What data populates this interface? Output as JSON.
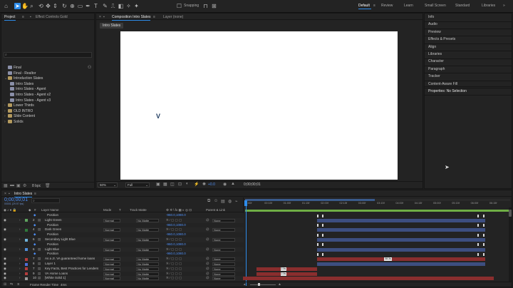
{
  "toolbar": {
    "snapping_label": "Snapping",
    "workspaces": [
      {
        "label": "Default",
        "active": true
      },
      {
        "label": "Review",
        "active": false
      },
      {
        "label": "Learn",
        "active": false
      },
      {
        "label": "Small Screen",
        "active": false
      },
      {
        "label": "Standard",
        "active": false
      },
      {
        "label": "Libraries",
        "active": false
      }
    ]
  },
  "project_panel": {
    "tab_project": "Project",
    "tab_effect_controls": "Effect Controls Gold",
    "search_placeholder": "",
    "items": [
      {
        "label": "Final",
        "type": "comp",
        "indent": 0
      },
      {
        "label": "Final - Realtor",
        "type": "comp",
        "indent": 0
      },
      {
        "label": "Introduction Slates",
        "type": "folder",
        "indent": 0
      },
      {
        "label": "Intro Slates",
        "type": "comp",
        "indent": 1
      },
      {
        "label": "Intro Slates - Agent",
        "type": "comp",
        "indent": 1
      },
      {
        "label": "Intro Slates - Agent v2",
        "type": "comp",
        "indent": 1
      },
      {
        "label": "Intro Slates - Agent v3",
        "type": "comp",
        "indent": 1
      },
      {
        "label": "Lower Thirds",
        "type": "folder",
        "indent": 0
      },
      {
        "label": "OLD INTRO",
        "type": "folder",
        "indent": 0
      },
      {
        "label": "Slide Content",
        "type": "folder",
        "indent": 0
      },
      {
        "label": "Solids",
        "type": "folder",
        "indent": 0
      }
    ],
    "bpc_label": "8 bpc"
  },
  "composition_panel": {
    "tab_composition": "Composition Intro Slates",
    "tab_layer": "Layer (none)",
    "breadcrumb": "Intro Slates",
    "canvas_text": "V",
    "zoom": "50%",
    "resolution": "Full",
    "exposure": "+0.0",
    "timecode": "0;00;00;01"
  },
  "right_panel": {
    "items": [
      "Info",
      "Audio",
      "Preview",
      "Effects & Presets",
      "Align",
      "Libraries",
      "Character",
      "Paragraph",
      "Tracker",
      "Content-Aware Fill"
    ],
    "properties_label": "Properties: No Selection"
  },
  "timeline": {
    "tab_label": "Intro Slates",
    "timecode": "0;00;00;01",
    "fps_label": "00001 (29.97 fps)",
    "headers": {
      "layer_name": "Layer Name",
      "mode": "Mode",
      "trk_matte": "Track Matte",
      "parent": "Parent & Link"
    },
    "ruler": [
      "0:00f",
      "00:15f",
      "01:00f",
      "01:15f",
      "02:00f",
      "02:15f",
      "03:00f",
      "03:15f",
      "04:00f",
      "04:15f",
      "05:00f",
      "05:15f",
      "06:00f",
      "06:15f"
    ],
    "rows": [
      {
        "num": "",
        "name": "Position",
        "color": "",
        "is_prop": true,
        "value": "-960.0,1080.0"
      },
      {
        "num": "2",
        "name": "Light Green",
        "color": "#5fa35f",
        "is_prop": false,
        "mode": "Normal",
        "matte": "No Matte",
        "parent": "None"
      },
      {
        "num": "",
        "name": "Position",
        "color": "",
        "is_prop": true,
        "value": "-960.0,1080.0"
      },
      {
        "num": "4",
        "name": "Dark Green",
        "color": "#2f7a3a",
        "is_prop": false,
        "mode": "Normal",
        "matte": "No Matte",
        "parent": "None"
      },
      {
        "num": "",
        "name": "Position",
        "color": "",
        "is_prop": true,
        "value": "-960.0,1080.0"
      },
      {
        "num": "6",
        "name": "Secondary Light Blue",
        "color": "#6fb2d8",
        "is_prop": false,
        "mode": "Normal",
        "matte": "No Matte",
        "parent": "None"
      },
      {
        "num": "",
        "name": "Position",
        "color": "",
        "is_prop": true,
        "value": "-960.0,1080.0"
      },
      {
        "num": "6",
        "name": "Light Blue",
        "color": "#4f8ed8",
        "is_prop": false,
        "mode": "Normal",
        "matte": "No Matte",
        "parent": "None"
      },
      {
        "num": "",
        "name": "Position",
        "color": "",
        "is_prop": true,
        "value": "-960.0,1080.0"
      },
      {
        "num": "7",
        "name": "As a Jr. VA guaranteed home loans",
        "color": "#b43c3c",
        "is_prop": false,
        "mode": "Normal",
        "matte": "No Matte",
        "parent": "None"
      },
      {
        "num": "8",
        "name": "Layer 1",
        "color": "#4f6fd8",
        "is_prop": false,
        "mode": "Normal",
        "matte": "No Matte",
        "parent": "None"
      },
      {
        "num": "7",
        "name": "Key Facts, Best Practices for Lenders",
        "color": "#b43c3c",
        "is_prop": false,
        "mode": "Normal",
        "matte": "No Matte",
        "parent": "None"
      },
      {
        "num": "9",
        "name": "VA Home Loans",
        "color": "#b43c3c",
        "is_prop": false,
        "mode": "Normal",
        "matte": "No Matte",
        "parent": "None"
      },
      {
        "num": "10",
        "name": "[White Solid 1]",
        "color": "#9a9a9a",
        "is_prop": false,
        "mode": "Normal",
        "matte": "No Matte",
        "parent": "None"
      }
    ],
    "bars": [
      {
        "label": "",
        "color": "#3d4e80",
        "start": 0.28,
        "end": 0.92
      },
      {
        "label": "",
        "color": "#3d4e80",
        "start": 0.28,
        "end": 0.92
      },
      {
        "label": "",
        "color": "#3d4e80",
        "start": 0.28,
        "end": 0.92
      },
      {
        "label": "",
        "color": "#3d4e80",
        "start": 0.28,
        "end": 0.92
      },
      {
        "label": "58.3s",
        "color": "#8a2e2e",
        "start": 0.28,
        "end": 0.92
      },
      {
        "label": "",
        "color": "#3d4e80",
        "start": 0.28,
        "end": 0.92
      },
      {
        "label": "2.5s",
        "color": "#8a2e2e",
        "start": 0.05,
        "end": 0.28
      },
      {
        "label": "2.5s",
        "color": "#8a2e2e",
        "start": 0.05,
        "end": 0.28
      },
      {
        "label": "",
        "color": "#8a2e2e",
        "start": 0.0,
        "end": 0.95
      }
    ],
    "frame_render_label": "Frame Render Time",
    "frame_render_value": "4ms"
  }
}
